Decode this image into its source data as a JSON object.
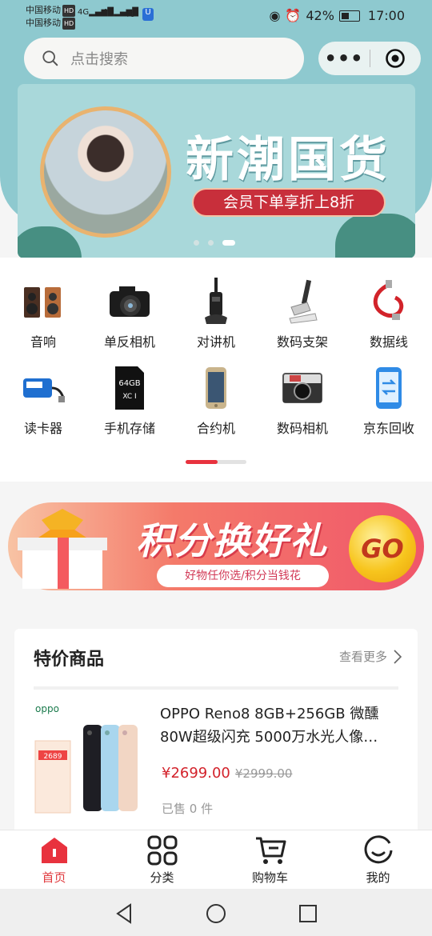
{
  "status": {
    "carrier1": "中国移动",
    "carrier2": "中国移动",
    "hd": "HD",
    "net1": "4G",
    "net2": "4G",
    "battery": "42%",
    "time": "17:00"
  },
  "search": {
    "placeholder": "点击搜索"
  },
  "capsule": {
    "menu": "•••"
  },
  "banner": {
    "title": "新潮国货",
    "subtitle": "会员下单享折上8折",
    "active_slide_index": 2,
    "slide_count": 3
  },
  "categories": [
    {
      "label": "音响",
      "icon": "speaker-icon"
    },
    {
      "label": "单反相机",
      "icon": "dslr-camera-icon"
    },
    {
      "label": "对讲机",
      "icon": "walkie-talkie-icon"
    },
    {
      "label": "数码支架",
      "icon": "phone-stand-icon"
    },
    {
      "label": "数据线",
      "icon": "cable-icon"
    },
    {
      "label": "读卡器",
      "icon": "card-reader-icon"
    },
    {
      "label": "手机存储",
      "icon": "sd-card-icon"
    },
    {
      "label": "合约机",
      "icon": "smartphone-icon"
    },
    {
      "label": "数码相机",
      "icon": "digital-camera-icon"
    },
    {
      "label": "京东回收",
      "icon": "recycle-phone-icon"
    }
  ],
  "pager": {
    "progress": 0.53
  },
  "promo": {
    "title": "积分换好礼",
    "subtitle": "好物任你选/积分当钱花",
    "go": "GO"
  },
  "deals": {
    "title": "特价商品",
    "more": "查看更多",
    "product": {
      "brand": "oppo",
      "name": "OPPO Reno8 8GB+256GB 微醺 80W超级闪充 5000万水光人像…",
      "price": "¥2699.00",
      "old_price": "¥2999.00",
      "sold": "已售 0 件",
      "tag_price": "2689"
    }
  },
  "tabs": [
    {
      "label": "首页",
      "icon": "home-icon",
      "active": true
    },
    {
      "label": "分类",
      "icon": "category-grid-icon",
      "active": false
    },
    {
      "label": "购物车",
      "icon": "cart-icon",
      "active": false
    },
    {
      "label": "我的",
      "icon": "profile-icon",
      "active": false
    }
  ],
  "colors": {
    "accent": "#e8323e",
    "header": "#8ec9cf",
    "price": "#d3222b"
  }
}
